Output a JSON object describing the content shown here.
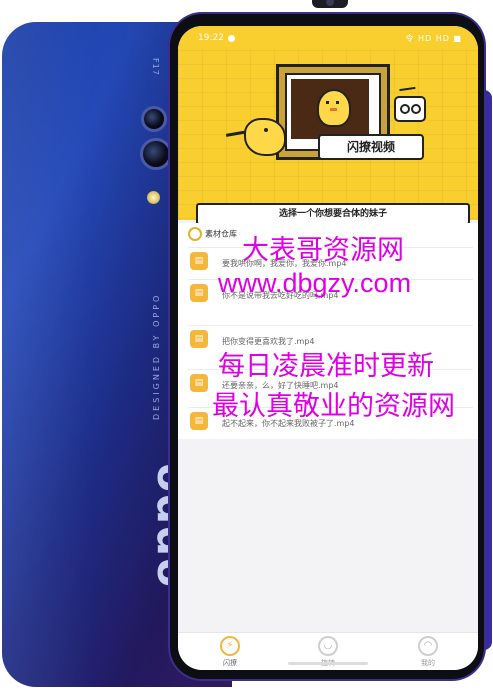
{
  "status_bar": {
    "time": "19:22",
    "indicators": "令 HD HD ■"
  },
  "hero": {
    "title": "闪撩视频",
    "select_prompt": "选择一个你想要合体的妹子"
  },
  "library": {
    "header": "素材仓库",
    "items": [
      {
        "name": "要我哄你啊，我爱你，我爱你.mp4"
      },
      {
        "name": "你不是说带我去吃好吃的吗.mp4"
      },
      {
        "name": "把你变得更喜欢我了.mp4"
      },
      {
        "name": "还要亲亲，么，好了快睡吧.mp4"
      },
      {
        "name": "起不起来，你不起来我败被子了.mp4"
      }
    ]
  },
  "tabs": [
    {
      "label": "闪撩",
      "icon": "lightning-icon",
      "active": true
    },
    {
      "label": "旋转",
      "icon": "face-icon",
      "active": false
    },
    {
      "label": "我的",
      "icon": "user-icon",
      "active": false
    }
  ],
  "phone": {
    "brand": "oppo",
    "back_text": "DESIGNED BY OPPO",
    "model": "F17"
  },
  "watermark": {
    "line1": "大表哥资源网",
    "line2": "www.dbgzy.com",
    "line3": "每日凌晨准时更新",
    "line4": "最认真敬业的资源网"
  },
  "colors": {
    "accent": "#f9cf2f",
    "icon_orange": "#f5b73a",
    "watermark": "#e000e8",
    "phone_blue": "#1d2c86"
  }
}
